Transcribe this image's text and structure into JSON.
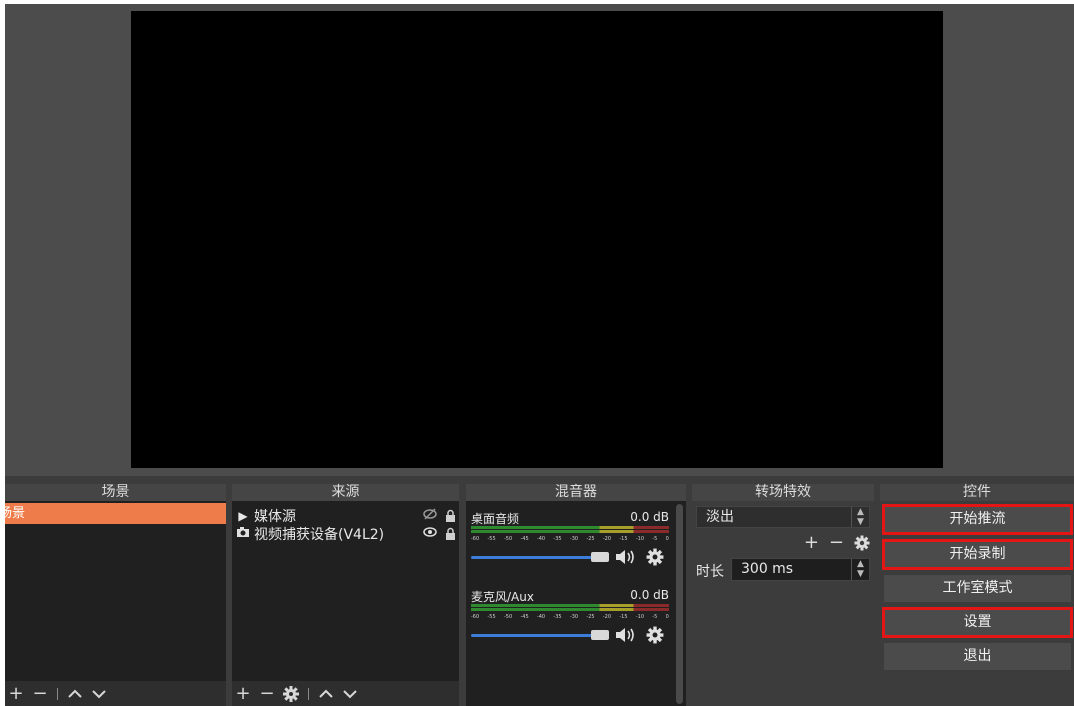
{
  "docks": {
    "scenes": {
      "title": "场景",
      "items": [
        "场景"
      ]
    },
    "sources": {
      "title": "来源",
      "items": [
        {
          "label": "媒体源",
          "type_icon": "play-icon",
          "visibility_icon": "eye-hidden-icon"
        },
        {
          "label": "视频捕获设备(V4L2)",
          "type_icon": "camera-icon",
          "visibility_icon": "eye-icon"
        }
      ]
    },
    "mixer": {
      "title": "混音器",
      "channels": [
        {
          "name": "桌面音频",
          "db": "0.0 dB"
        },
        {
          "name": "麦克风/Aux",
          "db": "0.0 dB"
        }
      ],
      "scale": [
        "-60",
        "-55",
        "-50",
        "-45",
        "-40",
        "-35",
        "-30",
        "-25",
        "-20",
        "-15",
        "-10",
        "-5",
        "0"
      ]
    },
    "transitions": {
      "title": "转场特效",
      "selected": "淡出",
      "duration_label": "时长",
      "duration_value": "300 ms"
    },
    "controls": {
      "title": "控件",
      "buttons": [
        "开始推流",
        "开始录制",
        "工作室模式",
        "设置",
        "退出"
      ]
    }
  },
  "colors": {
    "accent_scene": "#ee7c4a",
    "highlight": "#e41515",
    "fader": "#3b7dd8"
  }
}
